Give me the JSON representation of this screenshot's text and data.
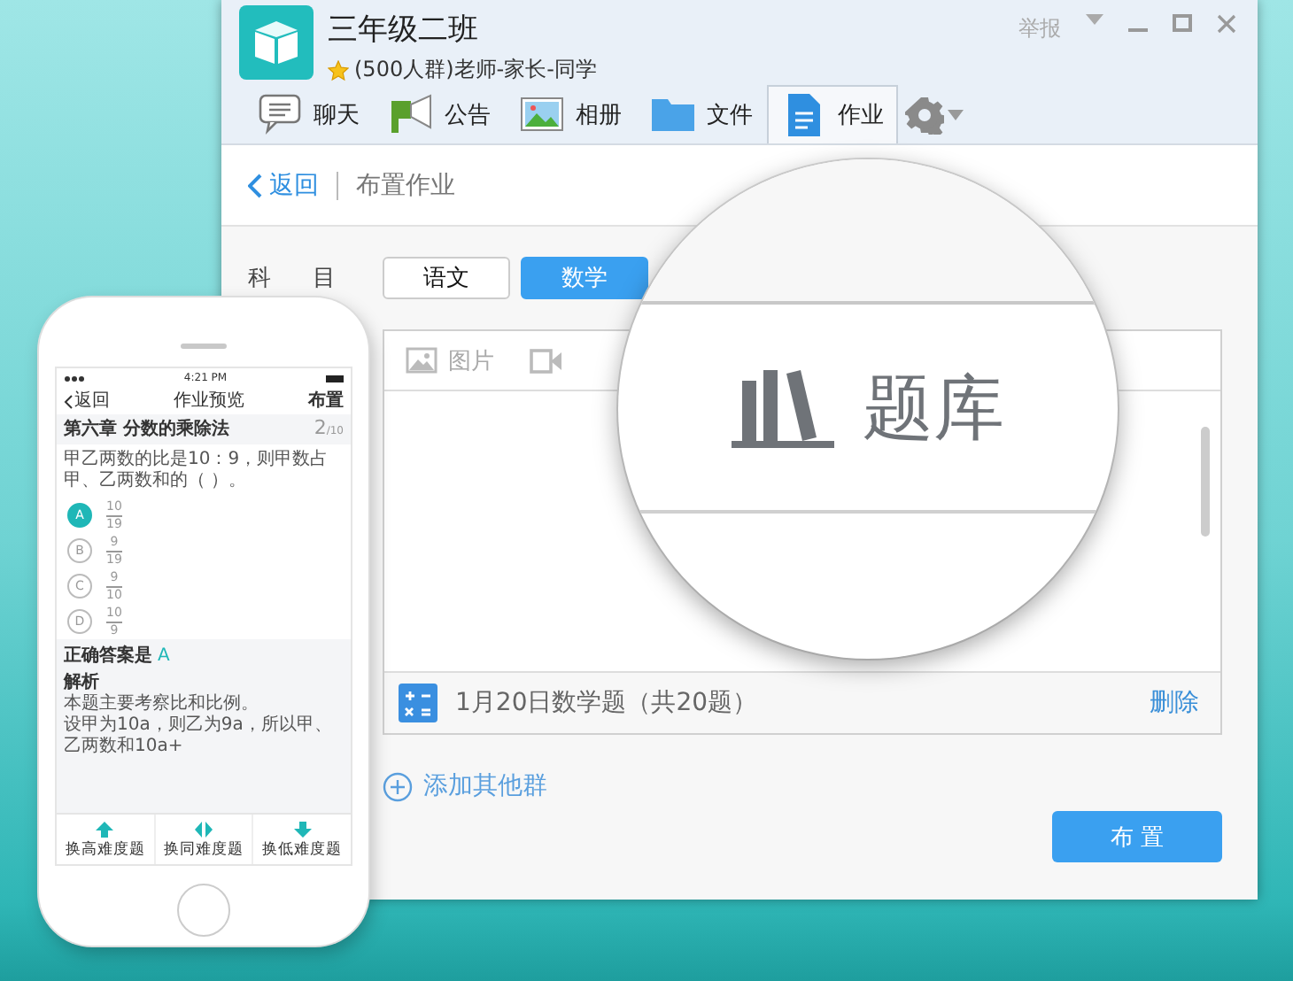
{
  "window": {
    "title": "三年级二班",
    "subtitle": "(500人群)老师-家长-同学",
    "report": "举报",
    "tabs": [
      {
        "label": "聊天",
        "kind": "chat",
        "selected": false
      },
      {
        "label": "公告",
        "kind": "notice",
        "selected": false
      },
      {
        "label": "相册",
        "kind": "album",
        "selected": false
      },
      {
        "label": "文件",
        "kind": "file",
        "selected": false
      },
      {
        "label": "作业",
        "kind": "homework",
        "selected": true
      }
    ],
    "header": {
      "back": "返回",
      "title": "布置作业"
    },
    "subject_label": "科目",
    "subjects": [
      {
        "label": "语文",
        "selected": false
      },
      {
        "label": "数学",
        "selected": true
      }
    ],
    "toolbar": {
      "image_label": "图片"
    },
    "attachment": {
      "title": "1月20日数学题（共20题）",
      "action": "删除"
    },
    "add_group": "添加其他群",
    "submit": "布 置"
  },
  "magnifier": {
    "label": "题库"
  },
  "phone": {
    "status_time": "4:21 PM",
    "nav": {
      "back": "返回",
      "title": "作业预览",
      "action": "布置"
    },
    "chapter": "第六章  分数的乘除法",
    "progress": "2",
    "progress_total": "/10",
    "question": "甲乙两数的比是10：9，则甲数占甲、乙两数和的（ ）。",
    "options": [
      {
        "letter": "A",
        "numerator": "10",
        "denominator": "19",
        "selected": true
      },
      {
        "letter": "B",
        "numerator": "9",
        "denominator": "19",
        "selected": false
      },
      {
        "letter": "C",
        "numerator": "9",
        "denominator": "10",
        "selected": false
      },
      {
        "letter": "D",
        "numerator": "10",
        "denominator": "9",
        "selected": false
      }
    ],
    "answer_label": "正确答案是",
    "answer": "A",
    "analysis_title": "解析",
    "analysis": [
      "本题主要考察比和比例。",
      "设甲为10a，则乙为9a，所以甲、乙两数和10a+"
    ],
    "buttons": [
      {
        "label": "换高难度题",
        "kind": "up"
      },
      {
        "label": "换同难度题",
        "kind": "same"
      },
      {
        "label": "换低难度题",
        "kind": "down"
      }
    ]
  }
}
